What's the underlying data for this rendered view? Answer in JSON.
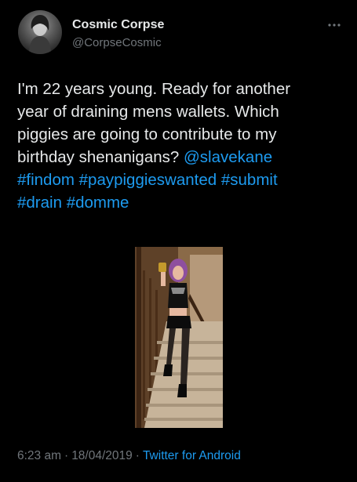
{
  "author": {
    "display_name": "Cosmic Corpse",
    "handle": "@CorpseCosmic"
  },
  "icons": {
    "more": "more-horizontal-icon"
  },
  "tweet": {
    "lines": [
      {
        "text": "I'm 22 years young. Ready for another"
      },
      {
        "text": "year of draining mens wallets. Which"
      },
      {
        "text": "piggies are going to contribute to my"
      },
      {
        "text": "birthday shenanigans? ",
        "mention": "@slavekane"
      },
      {
        "tags": [
          "#findom",
          "#paypiggieswanted",
          "#submit"
        ]
      },
      {
        "tags": [
          "#drain",
          "#domme"
        ]
      }
    ]
  },
  "meta": {
    "time": "6:23 am",
    "separator": "·",
    "date": "18/04/2019",
    "source": "Twitter for Android"
  },
  "colors": {
    "background": "#000000",
    "text": "#e7e9ea",
    "secondary": "#71767b",
    "link": "#1d9bf0"
  }
}
